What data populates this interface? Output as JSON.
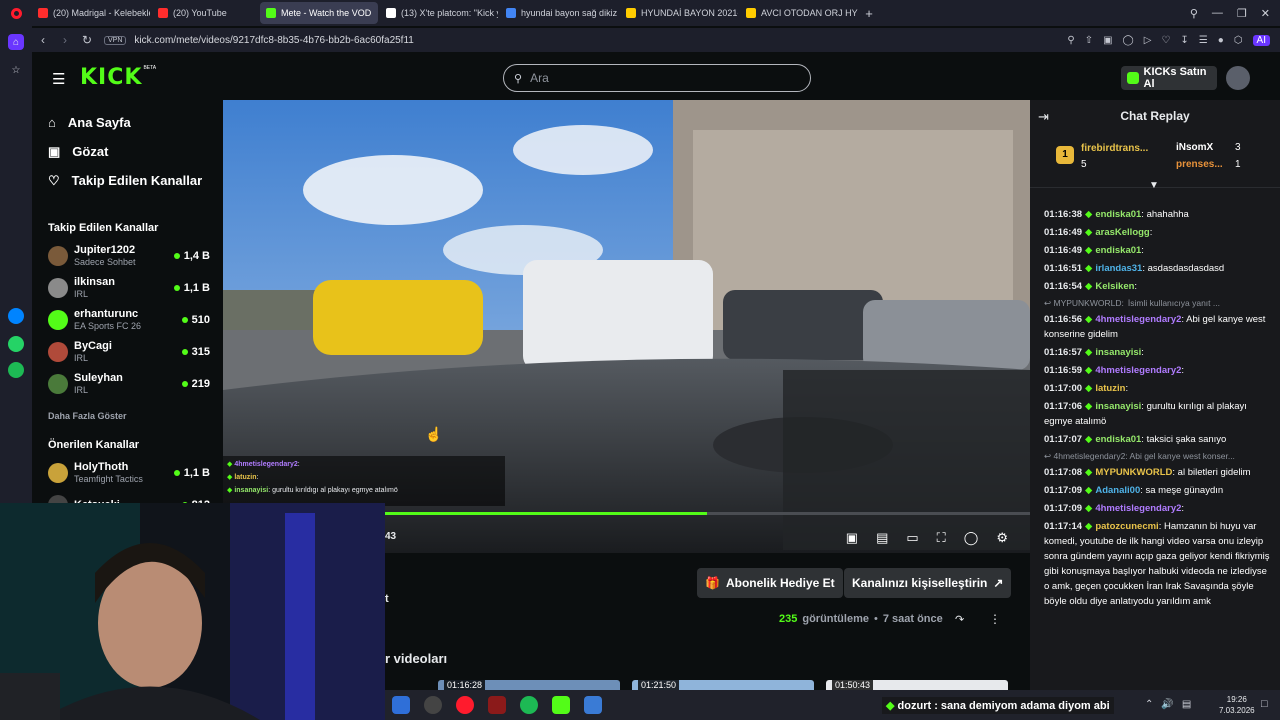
{
  "browser": {
    "tabs": [
      {
        "label": "(20) Madrigal - Kelebekler",
        "color": "#ff2d2d"
      },
      {
        "label": "(20) YouTube",
        "color": "#ff2d2d"
      },
      {
        "label": "Mete - Watch the VOD",
        "color": "#53fc18",
        "active": true
      },
      {
        "label": "(13) X'te platcom: \"Kick y",
        "color": "#ffffff"
      },
      {
        "label": "hyundai bayon sağ dikiz a",
        "color": "#4285f4"
      },
      {
        "label": "HYUNDAİ BAYON 2021-2",
        "color": "#ffcc00"
      },
      {
        "label": "AVCI OTODAN ORJ HYUN",
        "color": "#ffcc00"
      }
    ],
    "new_tab": "+",
    "url": "kick.com/mete/videos/9217dfc8-8b35-4b76-bb2b-6ac60fa25f11",
    "vpn": "VPN",
    "ai_label": "AI"
  },
  "brand": {
    "logo": "KICK",
    "beta": "BETA",
    "accent": "#53fc18"
  },
  "nav": {
    "home": "Ana Sayfa",
    "browse": "Gözat",
    "following": "Takip Edilen Kanallar"
  },
  "following_section": {
    "title": "Takip Edilen Kanallar",
    "channels": [
      {
        "name": "Jupiter1202",
        "category": "Sadece Sohbet",
        "viewers": "1,4 B",
        "avatar": "#7a5a3a"
      },
      {
        "name": "ilkinsan",
        "category": "IRL",
        "viewers": "1,1 B",
        "avatar": "#8a8a8a"
      },
      {
        "name": "erhanturunc",
        "category": "EA Sports FC 26",
        "viewers": "510",
        "avatar": "#53fc18"
      },
      {
        "name": "ByCagi",
        "category": "IRL",
        "viewers": "315",
        "avatar": "#b04a3a"
      },
      {
        "name": "Suleyhan",
        "category": "IRL",
        "viewers": "219",
        "avatar": "#4a7a3a"
      }
    ],
    "show_more": "Daha Fazla Göster"
  },
  "recommended_section": {
    "title": "Önerilen Kanallar",
    "channels": [
      {
        "name": "HolyThoth",
        "category": "Teamfight Tactics",
        "viewers": "1,1 B",
        "avatar": "#c9a23a"
      },
      {
        "name": "Ketsueki",
        "category": "",
        "viewers": "812",
        "avatar": "#444444"
      }
    ]
  },
  "search": {
    "placeholder": "Ara"
  },
  "header": {
    "buy_ai": "KICKs Satın Al"
  },
  "video": {
    "time_left": "43",
    "progress": 0.5,
    "overlay_chat": [
      {
        "user": "4hmetislegendary2",
        "text": ":"
      },
      {
        "user": "latuzin",
        "text": ":"
      },
      {
        "user": "insanayisi",
        "text": ": gurultu kırıldıgı al plakayı egmye atalımö"
      }
    ]
  },
  "below_video": {
    "gift_sub": "Abonelik Hediye Et",
    "customize": "Kanalınızı kişiselleştirin",
    "views_count": "235",
    "views_label": "görüntüleme",
    "ago": "7 saat önce",
    "partial_title": "t",
    "videos_heading": "r videoları",
    "thumb_times": [
      "01:16:28",
      "01:21:50",
      "01:50:43"
    ]
  },
  "chat": {
    "title": "Chat Replay",
    "leaders": [
      {
        "rank": "1",
        "name": "firebirdtrans...",
        "count": "5"
      },
      {
        "name": "iNsomX",
        "count": "3"
      },
      {
        "name": "prenses...",
        "count": "1"
      }
    ],
    "messages": [
      {
        "time": "01:16:38",
        "user": "endiska01",
        "color": "#95e86b",
        "text": ": ahahahha"
      },
      {
        "time": "01:16:49",
        "user": "arasKellogg",
        "color": "#95e86b",
        "text": ":"
      },
      {
        "time": "01:16:49",
        "user": "endiska01",
        "color": "#95e86b",
        "text": ":"
      },
      {
        "time": "01:16:51",
        "user": "irlandas31",
        "color": "#4fb3e8",
        "text": ": asdasdasdasdasd"
      },
      {
        "time": "01:16:54",
        "user": "Kelsiken",
        "color": "#95e86b",
        "text": ":"
      },
      {
        "reply": "MYPUNKWORLD:",
        "reply_text": "İsimli kullanıcıya yanıt ..."
      },
      {
        "time": "01:16:56",
        "user": "4hmetislegendary2",
        "color": "#b07cff",
        "text": ": Abi gel kanye west konserine gidelim"
      },
      {
        "time": "01:16:57",
        "user": "insanayisi",
        "color": "#95e86b",
        "text": ":"
      },
      {
        "time": "01:16:59",
        "user": "4hmetislegendary2",
        "color": "#b07cff",
        "text": ":"
      },
      {
        "time": "01:17:00",
        "user": "latuzin",
        "color": "#e8c34a",
        "text": ":"
      },
      {
        "time": "01:17:06",
        "user": "insanayisi",
        "color": "#95e86b",
        "text": ": gurultu kırılıgı al plakayı egmye atalımö"
      },
      {
        "time": "01:17:07",
        "user": "endiska01",
        "color": "#95e86b",
        "text": ": taksici şaka sanıyo"
      },
      {
        "reply": "4hmetislegendary2: Abi gel kanye west konser...",
        "reply_text": ""
      },
      {
        "time": "01:17:08",
        "user": "MYPUNKWORLD",
        "color": "#e8c34a",
        "text": ": al biletleri gidelim"
      },
      {
        "time": "01:17:09",
        "user": "Adanali00",
        "color": "#4fb3e8",
        "text": ": sa meşe günaydın"
      },
      {
        "time": "01:17:09",
        "user": "4hmetislegendary2",
        "color": "#b07cff",
        "text": ":"
      },
      {
        "time": "01:17:14",
        "user": "patozcunecmi",
        "color": "#e8c34a",
        "text": ": Hamzanın bi huyu var komedi, youtube de ilk hangi video varsa onu izleyip sonra gündem yayını açıp gaza geliyor kendi fikriymiş gibi konuşmaya başlıyor halbuki videoda ne izlediyse o amk, geçen çocukken İran Irak Savaşında şöyle böyle oldu diye anlatıyodu yarıldım amk"
      }
    ],
    "bottom": {
      "user": "dozurt",
      "text": ": sana demiyom adama diyom abi"
    }
  },
  "system": {
    "time": "19:26",
    "date": "7.03.2026"
  }
}
